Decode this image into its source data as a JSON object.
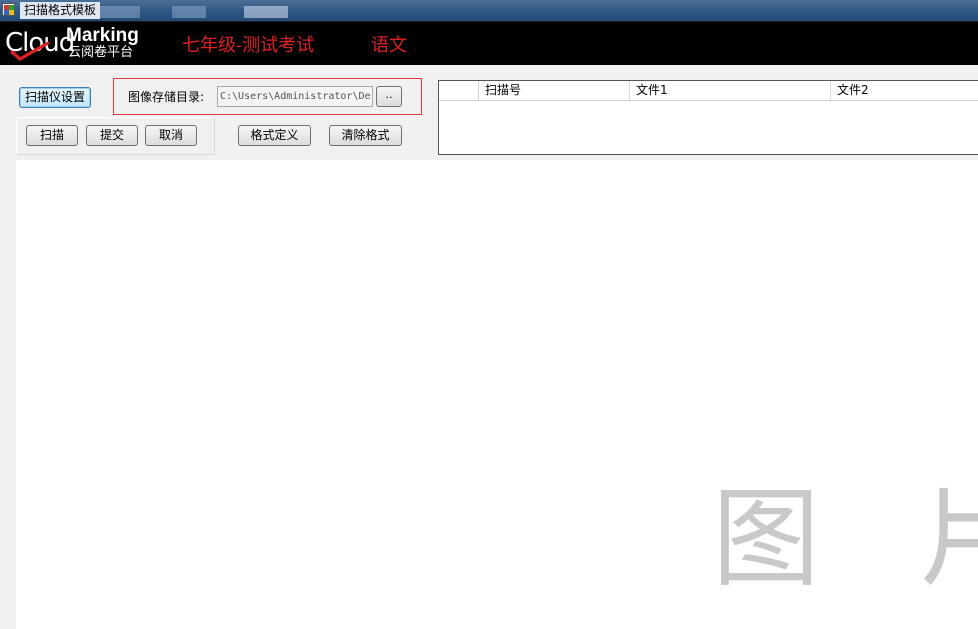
{
  "window": {
    "title": "扫描格式模板"
  },
  "banner": {
    "logo_brand": "Cloud",
    "logo_marking": "Marking",
    "logo_subtitle": "云阅卷平台",
    "exam_title": "七年级-测试考试",
    "exam_subject": "语文"
  },
  "toolbar": {
    "scanner_settings": "扫描仪设置",
    "scan": "扫描",
    "submit": "提交",
    "cancel": "取消",
    "define_format": "格式定义",
    "clear_format": "清除格式"
  },
  "storage": {
    "label": "图像存储目录:",
    "path": "C:\\Users\\Administrator\\De",
    "browse_label": ".."
  },
  "grid": {
    "columns": [
      "扫描号",
      "文件1",
      "文件2"
    ],
    "rows": []
  },
  "watermark": {
    "char1": "图",
    "char2": "片"
  },
  "colors": {
    "banner_bg": "#000000",
    "exam_title": "#e02020",
    "dir_box_border": "#e23a3a",
    "titlebar": "#2f5784"
  }
}
